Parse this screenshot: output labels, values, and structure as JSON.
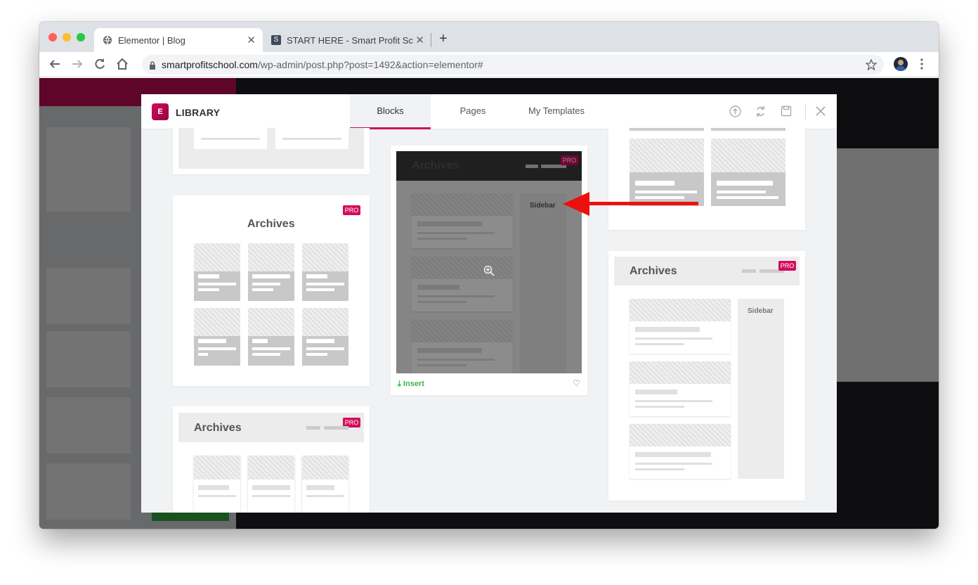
{
  "browser": {
    "tabs": [
      {
        "title": "Elementor | Blog",
        "active": true
      },
      {
        "title": "START HERE - Smart Profit Sc",
        "active": false
      }
    ],
    "new_tab": "+",
    "close_glyph": "✕",
    "url_domain": "smartprofitschool.com",
    "url_path": "/wp-admin/post.php?post=1492&action=elementor#"
  },
  "library": {
    "title": "LIBRARY",
    "logo": "E",
    "tabs": [
      "Blocks",
      "Pages",
      "My Templates"
    ],
    "active_tab": "Blocks",
    "icons": [
      "upload-icon",
      "sync-icon",
      "save-icon",
      "close-icon"
    ]
  },
  "templates": {
    "archives_label": "Archives",
    "sidebar_label": "Sidebar",
    "pro_badge": "PRO",
    "insert_label": "Insert"
  },
  "colors": {
    "elementor_pink": "#d30c5c",
    "insert_green": "#39b54a",
    "annotation_arrow": "#ee0f0f"
  }
}
